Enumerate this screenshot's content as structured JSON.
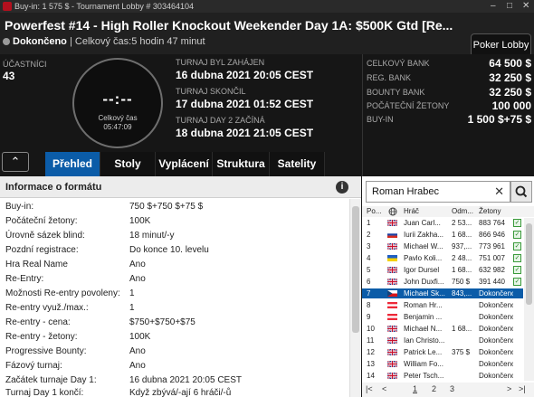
{
  "window": {
    "title": "Buy-in: 1 575 $ - Tournament Lobby # 303464104",
    "controls": [
      "–",
      "□",
      "✕"
    ]
  },
  "header": {
    "title": "Powerfest #14 - High Roller Knockout Weekender Day 1A: $500K Gtd [Re...",
    "status": "Dokončeno",
    "total_time": "| Celkový čas:5 hodin  47 minut",
    "lobby_button": "Poker Lobby"
  },
  "summary": {
    "participants_label": "ÚČASTNÍCI",
    "participants": "43",
    "clock": {
      "digits": "--:--",
      "label": "Celkový čas",
      "time": "05:47:09"
    },
    "started_label": "TURNAJ BYL ZAHÁJEN",
    "started": "16 dubna 2021   20:05 CEST",
    "ended_label": "TURNAJ SKONČIL",
    "ended": "17 dubna 2021   01:52 CEST",
    "day2_label": "TURNAJ DAY 2 ZAČÍNÁ",
    "day2": "18 dubna 2021   21:05 CEST"
  },
  "bank": [
    {
      "k": "CELKOVÝ BANK",
      "v": "64 500 $"
    },
    {
      "k": "REG. BANK",
      "v": "32 250 $"
    },
    {
      "k": "BOUNTY BANK",
      "v": "32 250 $"
    },
    {
      "k": "POČÁTEČNÍ ŽETONY",
      "v": "100 000"
    },
    {
      "k": "BUY-IN",
      "v": "1 500 $+75 $"
    }
  ],
  "tabs": {
    "collapse": "⌃",
    "items": [
      "Přehled",
      "Stoly",
      "Vyplácení",
      "Struktura",
      "Satelity"
    ],
    "active": 0
  },
  "format": {
    "heading": "Informace o formátu",
    "info_icon": "i",
    "rows": [
      {
        "k": "Buy-in:",
        "v": "750 $+750 $+75 $"
      },
      {
        "k": "Počáteční žetony:",
        "v": "100K"
      },
      {
        "k": "Úrovně sázek blind:",
        "v": "18 minut/-y"
      },
      {
        "k": "Pozdní registrace:",
        "v": "Do konce 10. levelu"
      },
      {
        "k": "Hra Real Name",
        "v": "Ano"
      },
      {
        "k": "Re-Entry:",
        "v": "Ano"
      },
      {
        "k": "Možnosti Re-entry povoleny:",
        "v": "1"
      },
      {
        "k": "Re-entry využ./max.:",
        "v": "1"
      },
      {
        "k": "Re-entry - cena:",
        "v": "$750+$750+$75"
      },
      {
        "k": "Re-entry - žetony:",
        "v": "100K"
      },
      {
        "k": "Progressive Bounty:",
        "v": "Ano"
      },
      {
        "k": "Fázový turnaj:",
        "v": "Ano"
      },
      {
        "k": "Začátek turnaje Day 1:",
        "v": "16 dubna 2021  20:05 CEST"
      },
      {
        "k": "Turnaj Day 1 končí:",
        "v": "Když zbývá/-ají 6 hráči/-ů"
      }
    ]
  },
  "players": {
    "search_value": "Roman Hrabec",
    "search_clear": "✕",
    "headers": {
      "pos": "Po...",
      "player": "Hráč",
      "win": "Odm...",
      "chips": "Žetony"
    },
    "rows": [
      {
        "pos": "1",
        "flag": "gb",
        "name": "Juan Carl...",
        "win": "2 53...",
        "chips": "883 764",
        "done": true
      },
      {
        "pos": "2",
        "flag": "ru",
        "name": "Iurii Zakha...",
        "win": "1 68...",
        "chips": "866 946",
        "done": true
      },
      {
        "pos": "3",
        "flag": "gb",
        "name": "Michael W...",
        "win": "937,...",
        "chips": "773 961",
        "done": true
      },
      {
        "pos": "4",
        "flag": "ua",
        "name": "Pavlo Koli...",
        "win": "2 48...",
        "chips": "751 007",
        "done": true
      },
      {
        "pos": "5",
        "flag": "gb",
        "name": "Igor Dursel",
        "win": "1 68...",
        "chips": "632 982",
        "done": true
      },
      {
        "pos": "6",
        "flag": "gb",
        "name": "John Duxfi...",
        "win": "750 $",
        "chips": "391 440",
        "done": true
      },
      {
        "pos": "7",
        "flag": "cz",
        "name": "Michael Sk...",
        "win": "843,...",
        "chips": "Dokončeno",
        "done": false,
        "selected": true
      },
      {
        "pos": "8",
        "flag": "at",
        "name": "Roman Hr...",
        "win": "",
        "chips": "Dokončeno",
        "done": false
      },
      {
        "pos": "9",
        "flag": "at",
        "name": "Benjamin ...",
        "win": "",
        "chips": "Dokončeno",
        "done": false
      },
      {
        "pos": "10",
        "flag": "gb",
        "name": "Michael N...",
        "win": "1 68...",
        "chips": "Dokončeno",
        "done": false
      },
      {
        "pos": "11",
        "flag": "gb",
        "name": "Ian Christo...",
        "win": "",
        "chips": "Dokončeno",
        "done": false
      },
      {
        "pos": "12",
        "flag": "gb",
        "name": "Patrick Le...",
        "win": "375 $",
        "chips": "Dokončeno",
        "done": false
      },
      {
        "pos": "13",
        "flag": "gb",
        "name": "William Fo...",
        "win": "",
        "chips": "Dokončeno",
        "done": false
      },
      {
        "pos": "14",
        "flag": "gb",
        "name": "Peter Tsch...",
        "win": "",
        "chips": "Dokončeno",
        "done": false
      }
    ],
    "pager": {
      "first": "|<",
      "prev": "<",
      "pages": [
        "1",
        "2",
        "3"
      ],
      "next": ">",
      "last": ">|"
    }
  },
  "colors": {
    "accent": "#0b5ca8",
    "brand": "#b3101e"
  }
}
